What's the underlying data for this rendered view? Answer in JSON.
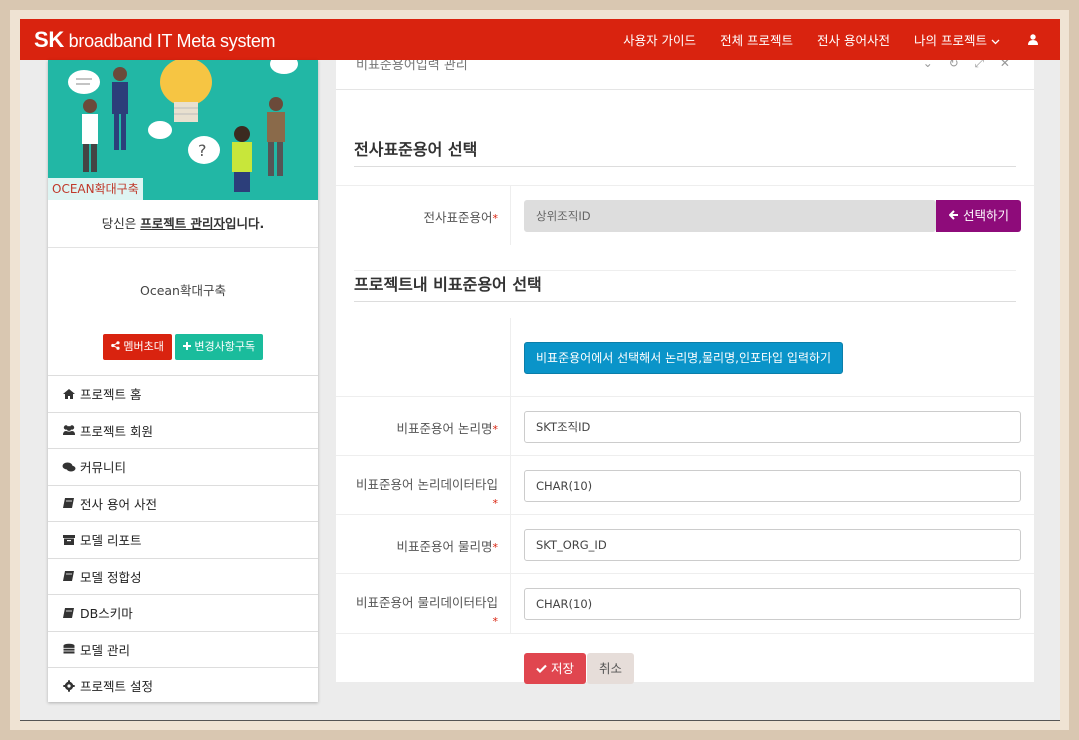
{
  "header": {
    "brand_sk": "SK",
    "brand_text": " broadband IT Meta system",
    "nav": [
      "사용자 가이드",
      "전체 프로젝트",
      "전사 용어사전",
      "나의 프로젝트"
    ],
    "bg_color": "#d9230f"
  },
  "sidebar": {
    "banner_tag": "OCEAN확대구축",
    "role_prefix": "당신은 ",
    "role_link": "프로젝트 관리자",
    "role_suffix": "입니다.",
    "project_name": "Ocean확대구축",
    "invite_button": "멤버초대",
    "subscribe_button": "변경사항구독",
    "menu": [
      {
        "label": "프로젝트 홈",
        "icon": "home-icon"
      },
      {
        "label": "프로젝트 회원",
        "icon": "users-icon"
      },
      {
        "label": "커뮤니티",
        "icon": "comments-icon"
      },
      {
        "label": "전사 용어 사전",
        "icon": "book-icon"
      },
      {
        "label": "모델 리포트",
        "icon": "archive-icon"
      },
      {
        "label": "모델 정합성",
        "icon": "book-icon"
      },
      {
        "label": "DB스키마",
        "icon": "book-icon"
      },
      {
        "label": "모델 관리",
        "icon": "database-icon"
      },
      {
        "label": "프로젝트 설정",
        "icon": "gear-icon"
      }
    ]
  },
  "panel": {
    "title_partial": "비표준용어입력 관리",
    "section1": "전사표준용어 선택",
    "section2": "프로젝트내 비표준용어 선택",
    "std_term_label": "전사표준용어",
    "std_term_value": "상위조직ID",
    "select_button": "선택하기",
    "blue_button": "비표준용어에서 선택해서 논리명,물리명,인포타입 입력하기",
    "fields": [
      {
        "label": "비표준용어 논리명",
        "value": "SKT조직ID"
      },
      {
        "label": "비표준용어 논리데이터타입",
        "value": "CHAR(10)"
      },
      {
        "label": "비표준용어 물리명",
        "value": "SKT_ORG_ID"
      },
      {
        "label": "비표준용어 물리데이터타입",
        "value": "CHAR(10)"
      }
    ],
    "required_mark": "*",
    "save_button": "저장",
    "cancel_button": "취소"
  }
}
